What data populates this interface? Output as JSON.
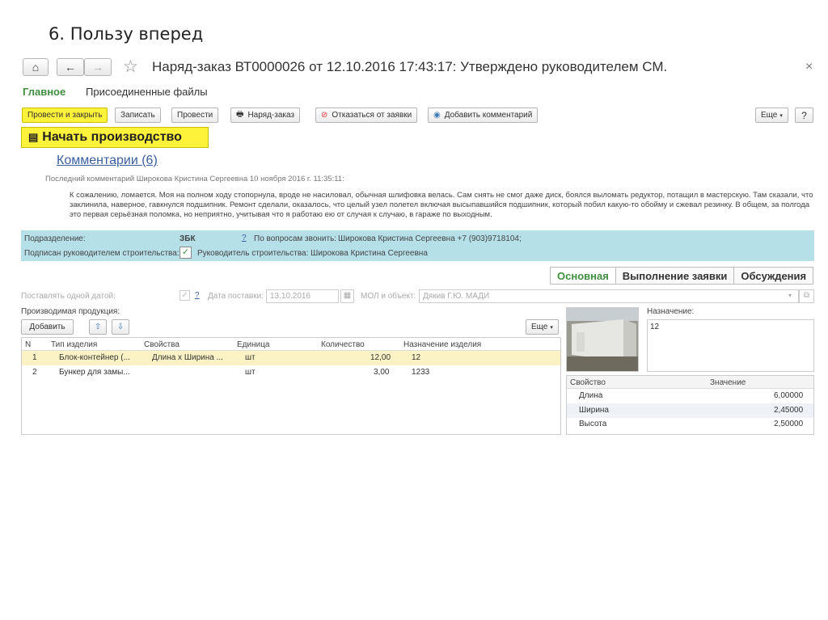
{
  "slide_title": "6. Пользу вперед",
  "window": {
    "title": "Наряд-заказ ВТ0000026 от 12.10.2016 17:43:17: Утверждено руководителем СМ.",
    "close": "×"
  },
  "icons": {
    "home": "⌂",
    "back": "←",
    "forward": "→",
    "star": "☆"
  },
  "tabs": {
    "main": "Главное",
    "files": "Присоединенные файлы"
  },
  "toolbar": {
    "post_close": "Провести и закрыть",
    "save": "Записать",
    "post": "Провести",
    "work_order": "Наряд-заказ",
    "reject": "Отказаться от заявки",
    "add_comment": "Добавить комментарий",
    "more": "Еще",
    "help": "?"
  },
  "start_production": "Начать производство",
  "comments": {
    "link": "Комментарии (6)",
    "last": "Последний комментарий Широкова Кристина Сергеевна 10 ноября 2016 г. 11:35:11:",
    "text": "К сожалению, ломается. Моя на полном ходу стопорнула, вроде не насиловал, обычная шлифовка велась. Сам снять не смог даже диск, боялся выломать редуктор, потащил в мастерскую. Там сказали, что заклинила, наверное, гавкнулся подшипник. Ремонт сделали, оказалось, что целый узел полетел включая высыпавшийся подшипник, который побил какую-то обойму и сжевал резинку. В общем, за полгода это первая серьёзная поломка, но неприятно, учитывая что я работаю ею от случая к случаю, в гараже по выходным."
  },
  "info": {
    "dept_label": "Подразделение:",
    "dept_value": "ЗБК",
    "help": "?",
    "contact_label": "По вопросам звонить:",
    "contact_value": "Широкова Кристина Сергеевна +7 (903)9718104;",
    "signed_label": "Подписан руководителем строительства:",
    "signed_check": "✓",
    "manager": "Руководитель строительства: Широкова Кристина Сергеевна"
  },
  "right_tabs": [
    "Основная",
    "Выполнение заявки",
    "Обсуждения"
  ],
  "delivery": {
    "one_date_label": "Поставлять одной датой:",
    "check": "✓",
    "help": "?",
    "date_label": "Дата поставки:",
    "date_value": "13.10.2016",
    "mol_label": "МОЛ и объект:",
    "mol_value": "Дякив Г.Ю. МАДИ"
  },
  "products": {
    "label": "Производимая продукция:",
    "add": "Добавить",
    "more": "Еще",
    "columns": [
      "N",
      "Тип изделия",
      "Свойства",
      "Единица",
      "Количество",
      "Назначение изделия"
    ],
    "rows": [
      [
        "1",
        "Блок-контейнер (...",
        "Длина х Ширина ...",
        "шт",
        "12,00",
        "12"
      ],
      [
        "2",
        "Бункер для замы...",
        "",
        "шт",
        "3,00",
        "1233"
      ]
    ]
  },
  "purpose": {
    "label": "Назначение:",
    "value": "12"
  },
  "properties": {
    "columns": [
      "Свойство",
      "Значение"
    ],
    "rows": [
      [
        "Длина",
        "6,00000"
      ],
      [
        "Ширина",
        "2,45000"
      ],
      [
        "Высота",
        "2,50000"
      ]
    ]
  }
}
